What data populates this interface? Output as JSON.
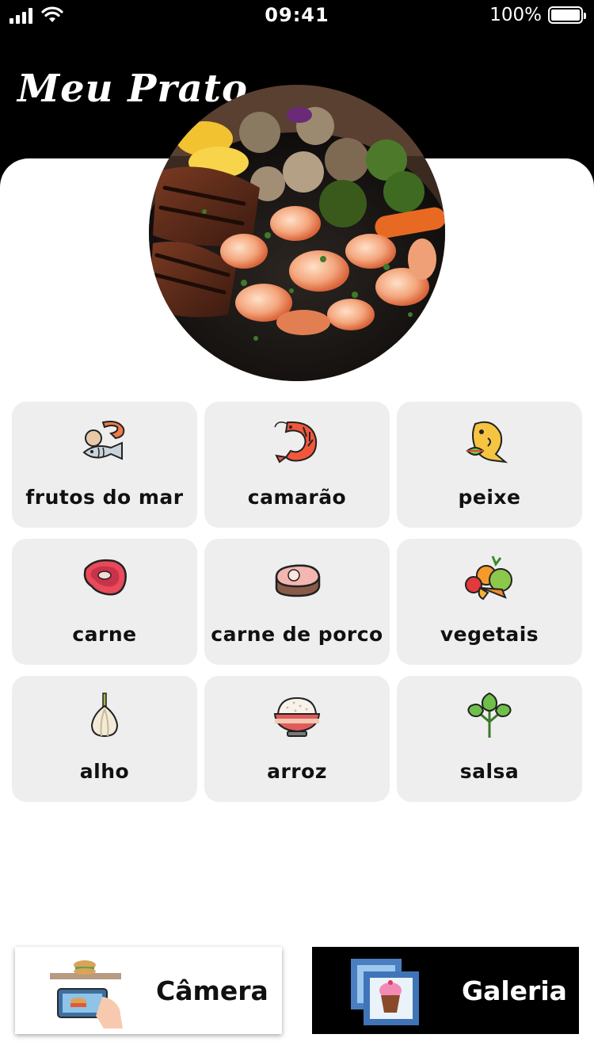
{
  "status_bar": {
    "time": "09:41",
    "battery_percent": "100%",
    "icons": [
      "signal-icon",
      "wifi-icon",
      "battery-icon"
    ]
  },
  "header": {
    "title": "Meu Prato"
  },
  "hero": {
    "image": "grilled-steak-shrimp-vegetables-photo"
  },
  "categories": [
    {
      "label": "frutos do mar",
      "icon": "seafood-icon"
    },
    {
      "label": "camarão",
      "icon": "shrimp-icon"
    },
    {
      "label": "peixe",
      "icon": "fish-icon"
    },
    {
      "label": "carne",
      "icon": "beef-steak-icon"
    },
    {
      "label": "carne de porco",
      "icon": "pork-meat-icon"
    },
    {
      "label": "vegetais",
      "icon": "vegetables-icon"
    },
    {
      "label": "alho",
      "icon": "garlic-icon"
    },
    {
      "label": "arroz",
      "icon": "rice-bowl-icon"
    },
    {
      "label": "salsa",
      "icon": "parsley-icon"
    }
  ],
  "actions": {
    "camera_label": "Câmera",
    "gallery_label": "Galeria"
  },
  "colors": {
    "header_bg": "#000000",
    "card_bg": "#eeeeee",
    "gallery_bg": "#000000"
  }
}
